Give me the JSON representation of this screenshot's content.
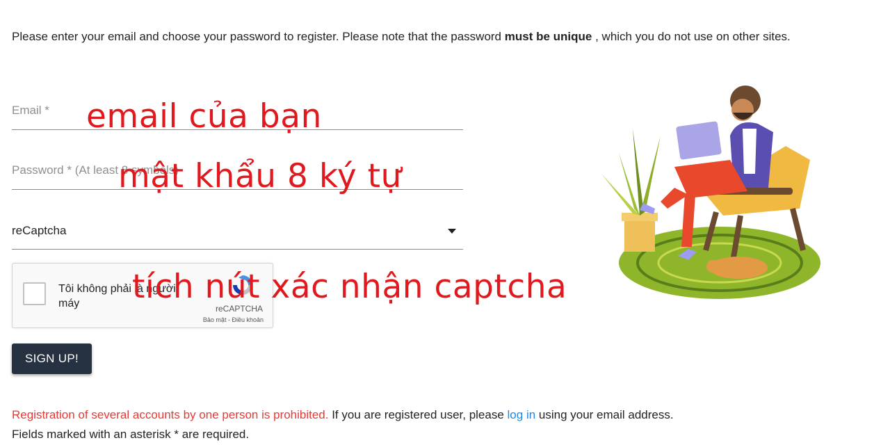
{
  "intro": {
    "part1": "Please enter your email and choose your password to register. Please note that the password ",
    "emphasis": "must be unique",
    "part2": " , which you do not use on other sites."
  },
  "form": {
    "email_placeholder": "Email *",
    "password_placeholder": "Password * (At least 8 symbols)",
    "captcha_select_value": "reCaptcha"
  },
  "recaptcha": {
    "checkbox_label": "Tôi không phải là người máy",
    "brand": "reCAPTCHA",
    "privacy": "Bảo mật",
    "separator": " - ",
    "terms": "Điều khoản"
  },
  "signup_button": "SIGN UP!",
  "footer": {
    "warning": "Registration of several accounts by one person is prohibited.",
    "text1": " If you are registered user, please ",
    "login_link": "log in",
    "text2": " using your email address.",
    "required_note": "Fields marked with an asterisk * are required."
  },
  "annotations": {
    "email_hint": "email của bạn",
    "password_hint": "mật khẩu 8 ký tự",
    "captcha_hint": "tích nút xác nhận captcha"
  },
  "colors": {
    "button_bg": "#263142",
    "warning_red": "#e53935",
    "link_blue": "#1e88e5",
    "annotation_red": "#e0191f"
  }
}
